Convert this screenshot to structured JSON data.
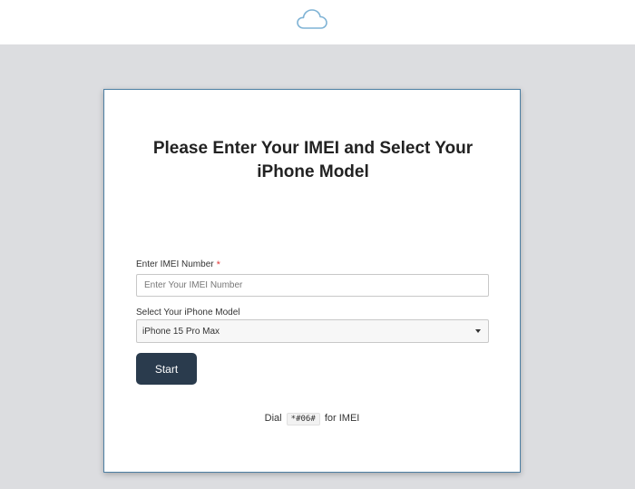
{
  "header": {
    "logo_icon": "cloud-icon",
    "accent": "#7fb3d5"
  },
  "form": {
    "title": "Please Enter Your IMEI and Select Your iPhone Model",
    "imei_label": "Enter IMEI Number",
    "imei_required_mark": "*",
    "imei_placeholder": "Enter Your IMEI Number",
    "imei_value": "",
    "model_label": "Select Your iPhone Model",
    "model_selected": "iPhone 15 Pro Max",
    "start_label": "Start",
    "hint_prefix": "Dial",
    "hint_code": "*#06#",
    "hint_suffix": "for IMEI"
  },
  "colors": {
    "button_bg": "#2a3b4d",
    "page_bg": "#dcdde0",
    "card_border": "#4d7fa3",
    "required": "#e23a3a"
  }
}
